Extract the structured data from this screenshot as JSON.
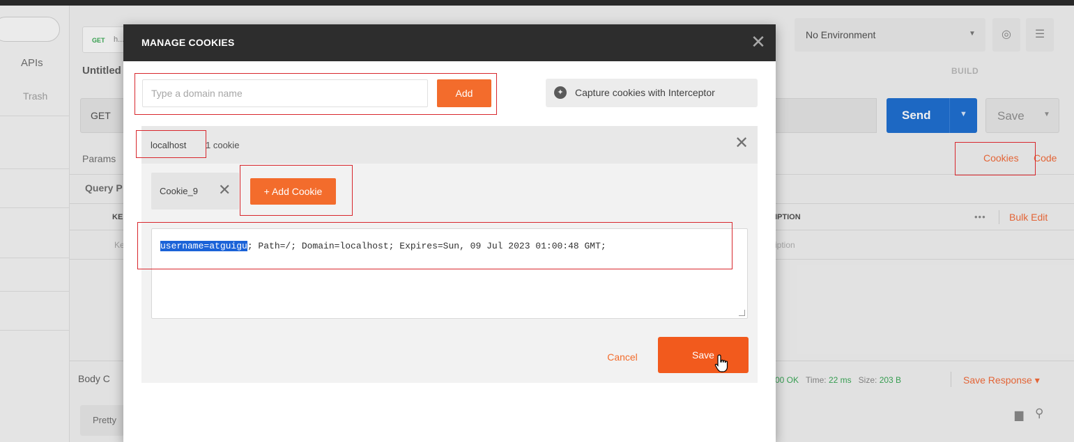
{
  "background": {
    "sidebar": {
      "apis": "APIs",
      "trash": "Trash"
    },
    "tab": {
      "method": "GET",
      "name": "h..."
    },
    "request": {
      "title": "Untitled",
      "method": "GET",
      "send": "Send",
      "save": "Save",
      "build": "BUILD",
      "params_tab": "Params",
      "query_title": "Query P",
      "key_header": "KE",
      "key_placeholder": "Ke",
      "desc_header": "IPTION",
      "desc_placeholder": "iption",
      "bulk_edit": "Bulk Edit",
      "more": "•••",
      "cookies_link": "Cookies",
      "code_link": "Code"
    },
    "environment": "No Environment",
    "response": {
      "body_tab": "Body  C",
      "status": "00 OK",
      "time_label": "Time:",
      "time_value": "22 ms",
      "size_label": "Size:",
      "size_value": "203 B",
      "save_response": "Save Response",
      "pretty": "Pretty"
    }
  },
  "modal": {
    "title": "MANAGE COOKIES",
    "domain_placeholder": "Type a domain name",
    "add_label": "Add",
    "interceptor_label": "Capture cookies with Interceptor",
    "domain": {
      "name": "localhost",
      "count": "1 cookie",
      "cookie_name": "Cookie_9",
      "add_cookie_label": "+ Add Cookie",
      "cookie_value_selected": "username=atguigu",
      "cookie_value_rest": "; Path=/; Domain=localhost; Expires=Sun, 09 Jul 2023 01:00:48 GMT;"
    },
    "cancel_label": "Cancel",
    "save_label": "Save"
  },
  "colors": {
    "accent": "#f36c2c",
    "send_blue": "#1f6fd0",
    "modal_header": "#2d2d2d",
    "annotation_red": "#d8262c"
  }
}
